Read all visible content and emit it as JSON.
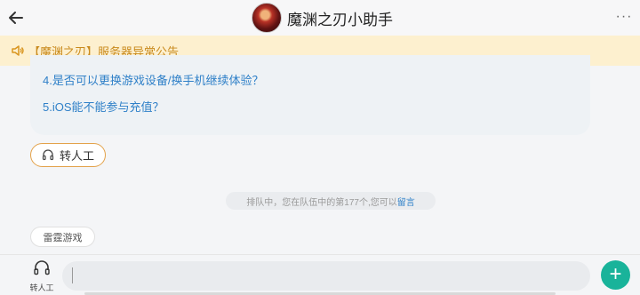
{
  "header": {
    "title": "魔渊之刃小助手",
    "back_icon": "arrow-left-icon",
    "more_icon": "more-horizontal-icon",
    "more_label": "···"
  },
  "notice": {
    "icon": "speaker-icon",
    "text": "【魔渊之刃】服务器异常公告"
  },
  "faq": {
    "items": [
      "4.是否可以更换游戏设备/换手机继续体验？",
      "5.iOS能不能参与充值？"
    ]
  },
  "actions": {
    "human_label": "转人工"
  },
  "system_message": {
    "text": "排队中，您在队伍中的第177个,您可以",
    "link": "留言"
  },
  "tag": {
    "label": "雷霆游戏"
  },
  "footer": {
    "human_label": "转人工",
    "input_value": "",
    "send_label": "+"
  },
  "colors": {
    "accent_orange": "#e3a24a",
    "link_blue": "#2f80c8",
    "send_green": "#19b39a",
    "notice_bg": "#fdf0cf"
  }
}
